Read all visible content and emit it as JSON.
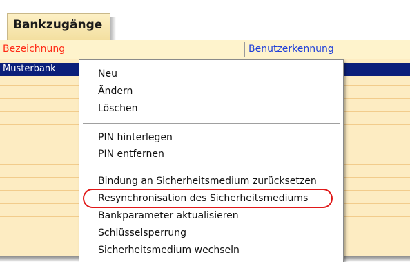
{
  "panel": {
    "title": "Bankzugänge"
  },
  "grid": {
    "columns": [
      "Bezeichnung",
      "Benutzerkennung"
    ],
    "selected_row": {
      "bezeichnung": "Musterbank"
    }
  },
  "context_menu": {
    "items": [
      "Neu",
      "Ändern",
      "Löschen",
      "PIN hinterlegen",
      "PIN entfernen",
      "Bindung an Sicherheitsmedium zurücksetzen",
      "Resynchronisation des Sicherheitsmediums",
      "Bankparameter aktualisieren",
      "Schlüsselsperrung",
      "Sicherheitsmedium wechseln"
    ],
    "highlighted_item": "Resynchronisation des Sicherheitsmediums"
  },
  "colors": {
    "header_bezeichnung": "#ff2a16",
    "header_benutzerkennung": "#1f3fd9",
    "selection": "#0b1f7a",
    "row_background": "#fdecc2",
    "highlight_oval": "#e01818"
  }
}
